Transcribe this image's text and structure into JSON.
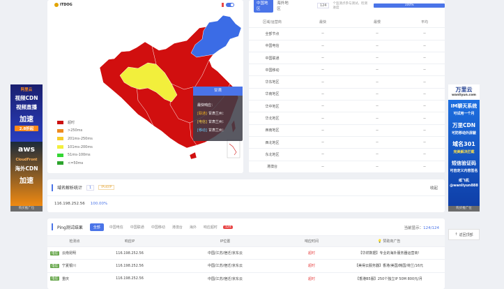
{
  "map": {
    "logo_text": "ITDOG",
    "legend": [
      {
        "label": "超时",
        "color": "#cc1111"
      },
      {
        "label": ">250ms",
        "color": "#ee8a1f"
      },
      {
        "label": "201ms-250ms",
        "color": "#f6cc2a"
      },
      {
        "label": "101ms-200ms",
        "color": "#f2ef3c"
      },
      {
        "label": "51ms-100ms",
        "color": "#33d633"
      },
      {
        "label": "<=50ms",
        "color": "#2da42d"
      }
    ],
    "tooltip": {
      "title": "甘肃",
      "subtitle": "最快响应：",
      "rows": [
        {
          "tag": "[联通]",
          "text": "甘肃兰州：",
          "color": "#f2b01e"
        },
        {
          "tag": "[电信]",
          "text": "甘肃兰州：",
          "color": "#ffd84a"
        },
        {
          "tag": "[移动]",
          "text": "甘肃兰州：",
          "color": "#6ad0ff"
        }
      ]
    }
  },
  "stats": {
    "tab_active": "中国地区",
    "tab_other": "海外地区",
    "node_count": "124",
    "progress_note": "个监测点参与测试，检测进度",
    "progress_label": "100%",
    "headers": [
      "区域/运营商",
      "最快",
      "最慢",
      "平均"
    ],
    "rows": [
      [
        "全部节点",
        "--",
        "--",
        "--"
      ],
      [
        "中国电信",
        "--",
        "--",
        "--"
      ],
      [
        "中国联通",
        "--",
        "--",
        "--"
      ],
      [
        "中国移动",
        "--",
        "--",
        "--"
      ],
      [
        "华东地区",
        "--",
        "--",
        "--"
      ],
      [
        "华南地区",
        "--",
        "--",
        "--"
      ],
      [
        "华中地区",
        "--",
        "--",
        "--"
      ],
      [
        "华北地区",
        "--",
        "--",
        "--"
      ],
      [
        "西南地区",
        "--",
        "--",
        "--"
      ],
      [
        "西北地区",
        "--",
        "--",
        "--"
      ],
      [
        "东北地区",
        "--",
        "--",
        "--"
      ],
      [
        "港澳台",
        "--",
        "--",
        "--"
      ]
    ]
  },
  "ads": {
    "left": {
      "brand1": "阿里云",
      "line1": "视频CDN",
      "line2": "视频直播",
      "line3": "加速",
      "price1": "2.8折起",
      "brand2": "aws",
      "line4": "CloudFront",
      "line5": "海外CDN",
      "line6": "加速",
      "caption": "购买推广位"
    },
    "right": {
      "brand": "万里云",
      "site": "wanliyun.com",
      "line1": "IM聊天系统",
      "line2": "可试用一个月",
      "line3": "万里CDN",
      "line4": "可防移动外屏蔽",
      "line5": "域名301",
      "line6": "完美解决拦截",
      "line7": "短信验证码",
      "line8": "可自定义内容签名",
      "tg": "纸飞机",
      "tg_handle": "@wanliyun888",
      "caption": "购买推广位"
    }
  },
  "domain_stats": {
    "title": "域名解析统计",
    "count": "1",
    "tag": "IPv4/IP",
    "collapse": "收起",
    "ip": "116.198.252.56",
    "percent": "100.00%"
  },
  "ping": {
    "title": "Ping测试结果",
    "filters": [
      "全部",
      "中国电信",
      "中国联通",
      "中国移动",
      "港澳台",
      "海外",
      "响应超时"
    ],
    "timeout_count": "124",
    "current_label": "当前显示：",
    "current_value": "124/124",
    "headers": [
      "检测点",
      "响应IP",
      "IP位置",
      "响应时间",
      "赞助商广告"
    ],
    "rows": [
      {
        "isp": "电信",
        "node": "云南昆明",
        "ip": "116.198.252.56",
        "loc": "中国/江苏/宿迁/京东云",
        "time": "超时",
        "ad": "【华祥数据】专业的海外服务器运营商!"
      },
      {
        "isp": "电信",
        "node": "宁夏银川",
        "ip": "116.198.252.56",
        "loc": "中国/江苏/宿迁/京东云",
        "time": "超时",
        "ad": "【美得云服务器】香港/美国/韩国/荷兰/16元"
      },
      {
        "isp": "电信",
        "node": "重庆",
        "ip": "116.198.252.56",
        "loc": "中国/江苏/宿迁/京东云",
        "time": "超时",
        "ad": "【香港B5服】250个独立IP 50M 800元/月"
      }
    ]
  },
  "backtop": "返回顶部"
}
